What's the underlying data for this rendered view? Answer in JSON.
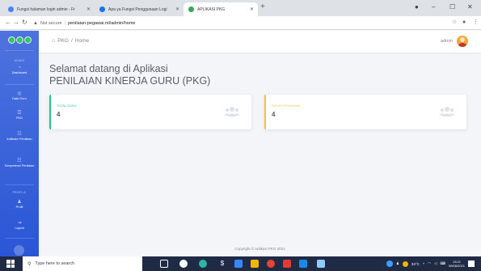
{
  "browser": {
    "tabs": [
      {
        "label": "Fungsi halaman login admin - Fr",
        "favicon_color": "#4285f4"
      },
      {
        "label": "Apa ya Fungsi Penggunaan Logi",
        "favicon_color": "#1a73e8"
      },
      {
        "label": "APLIKASI PKG",
        "favicon_color": "#34a853"
      }
    ],
    "address": {
      "warning": "Not secure",
      "url": "penilaian-pegawai.ml/admin/home"
    }
  },
  "sidebar": {
    "sections": [
      {
        "heading": "ADMIN",
        "items": [
          {
            "label": "Dashboard",
            "icon": "dashboard-icon"
          }
        ]
      },
      {
        "heading": "",
        "items": [
          {
            "label": "Data Guru",
            "icon": "users-icon"
          },
          {
            "label": "PKG",
            "icon": "list-icon"
          },
          {
            "label": "Indikator Penilaian",
            "icon": "table-icon"
          },
          {
            "label": "Kompetensi Penilaian",
            "icon": "table-icon"
          }
        ]
      },
      {
        "heading": "PROFILE",
        "items": [
          {
            "label": "Profil",
            "icon": "user-icon"
          },
          {
            "label": "Logout",
            "icon": "logout-icon"
          }
        ]
      }
    ]
  },
  "topbar": {
    "breadcrumb": [
      "PKG",
      "Home"
    ],
    "username": "admin"
  },
  "welcome": {
    "line1": "Selamat datang di Aplikasi",
    "line2": "PENILAIAN KINERJA GURU (PKG)"
  },
  "cards": [
    {
      "label": "TOTAL GURU",
      "value": "4",
      "accent": "#1cc88a",
      "icon": "users-icon"
    },
    {
      "label": "SUDAH PENILAIAN",
      "value": "4",
      "accent": "#f6c23e",
      "icon": "users-icon"
    }
  ],
  "footer": {
    "text": "Copyright © Aplikasi PKG 2021"
  },
  "taskbar": {
    "search_placeholder": "Type here to search",
    "weather": "34°C",
    "time": "13:21",
    "date": "09/08/2021",
    "apps": [
      {
        "name": "task-view-icon",
        "color": "#ffffff"
      },
      {
        "name": "widgets-icon",
        "color": "#ffffff"
      },
      {
        "name": "edge-icon",
        "color": "#2fb6a3"
      },
      {
        "name": "dollar-icon",
        "color": "#ffffff"
      },
      {
        "name": "store-icon",
        "color": "#3a86ff"
      },
      {
        "name": "folder-icon",
        "color": "#f4b400"
      },
      {
        "name": "chrome-icon",
        "color": "#ea4335"
      },
      {
        "name": "media-icon",
        "color": "#e53935"
      },
      {
        "name": "calendar-icon",
        "color": "#1e88e5"
      },
      {
        "name": "terminal-icon",
        "color": "#90caf9"
      }
    ]
  },
  "colors": {
    "sidebar": "#4e73df",
    "text": "#5a5c69",
    "muted": "#858796"
  }
}
